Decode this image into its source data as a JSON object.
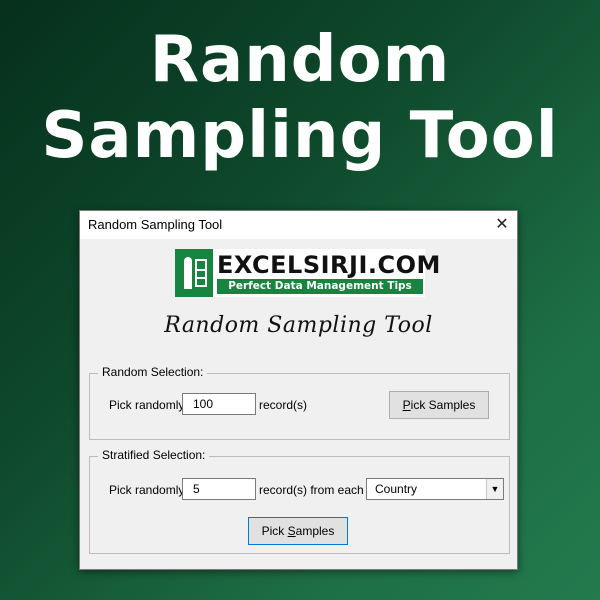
{
  "headline": {
    "line1": "Random",
    "line2": "Sampling Tool"
  },
  "dialog": {
    "window_title": "Random Sampling Tool",
    "close_glyph": "✕",
    "logo": {
      "brand": "EXCELSIRJI.COM",
      "tagline": "Perfect Data Management Tips"
    },
    "heading": "Random Sampling Tool",
    "random_selection": {
      "group_label": "Random Selection:",
      "pick_label": "Pick randomly",
      "count_value": "100",
      "unit_label": "record(s)",
      "button_prefix": "",
      "button_mnemonic": "P",
      "button_rest": "ick Samples"
    },
    "stratified_selection": {
      "group_label": "Stratified Selection:",
      "pick_label": "Pick randomly",
      "count_value": "5",
      "unit_label": "record(s) from each",
      "field_selected": "Country",
      "dropdown_arrow": "▼",
      "button_prefix": "Pick ",
      "button_mnemonic": "S",
      "button_rest": "amples"
    }
  }
}
